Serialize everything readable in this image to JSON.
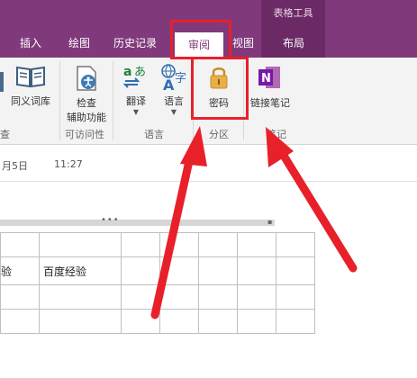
{
  "ribbon": {
    "context_group": "表格工具",
    "tabs": [
      "插入",
      "绘图",
      "历史记录",
      "审阅",
      "视图",
      "布局"
    ]
  },
  "toolbar": {
    "thesaurus": "同义词库",
    "accessibility": [
      "检查",
      "辅助功能"
    ],
    "translate": "翻译",
    "language": "语言",
    "password": "密码",
    "linked_notes": "链接笔记",
    "groups": {
      "truncated_left": "查",
      "accessibility": "可访问性",
      "language": "语言",
      "section": "分区",
      "notes": "笔记"
    }
  },
  "page": {
    "date": "月5日",
    "time": "11:27",
    "table_cells": [
      "验",
      "百度经验"
    ]
  },
  "colors": {
    "ribbon": "#80397b",
    "annotation": "#e8202a",
    "lock": "#e8b04a"
  }
}
